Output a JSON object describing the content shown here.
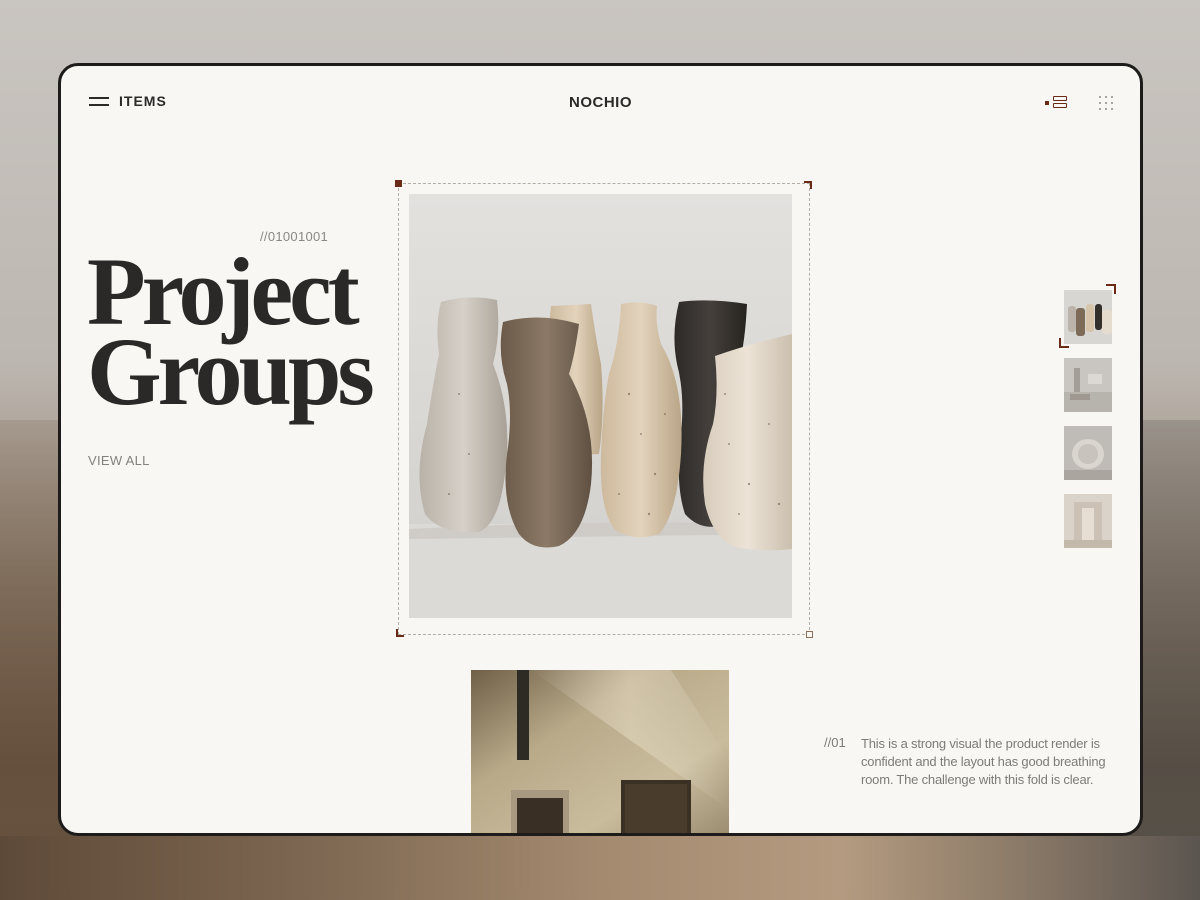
{
  "header": {
    "menu_label": "ITEMS",
    "brand": "NOCHIO",
    "icons": [
      "hamburger-icon",
      "list-view-icon",
      "grid-dots-icon"
    ]
  },
  "hero": {
    "code": "//01001001",
    "title_line1": "Project",
    "title_line2": "Groups",
    "view_all": "VIEW ALL"
  },
  "gallery": {
    "main_image": "ceramic-vases-photo",
    "thumbnails": [
      {
        "name": "ceramic-vases-thumb",
        "selected": true
      },
      {
        "name": "interior-room-thumb",
        "selected": false
      },
      {
        "name": "round-vase-thumb",
        "selected": false
      },
      {
        "name": "hallway-thumb",
        "selected": false
      }
    ],
    "second_image": "sunlit-wall-photo"
  },
  "caption": {
    "number": "//01",
    "text": "This is a strong visual the product render is confident and the layout has good breathing room. The challenge with this fold is clear."
  },
  "colors": {
    "accent": "#6b2a17",
    "background": "#f8f7f4",
    "text": "#2a2927",
    "muted": "#84817d"
  }
}
